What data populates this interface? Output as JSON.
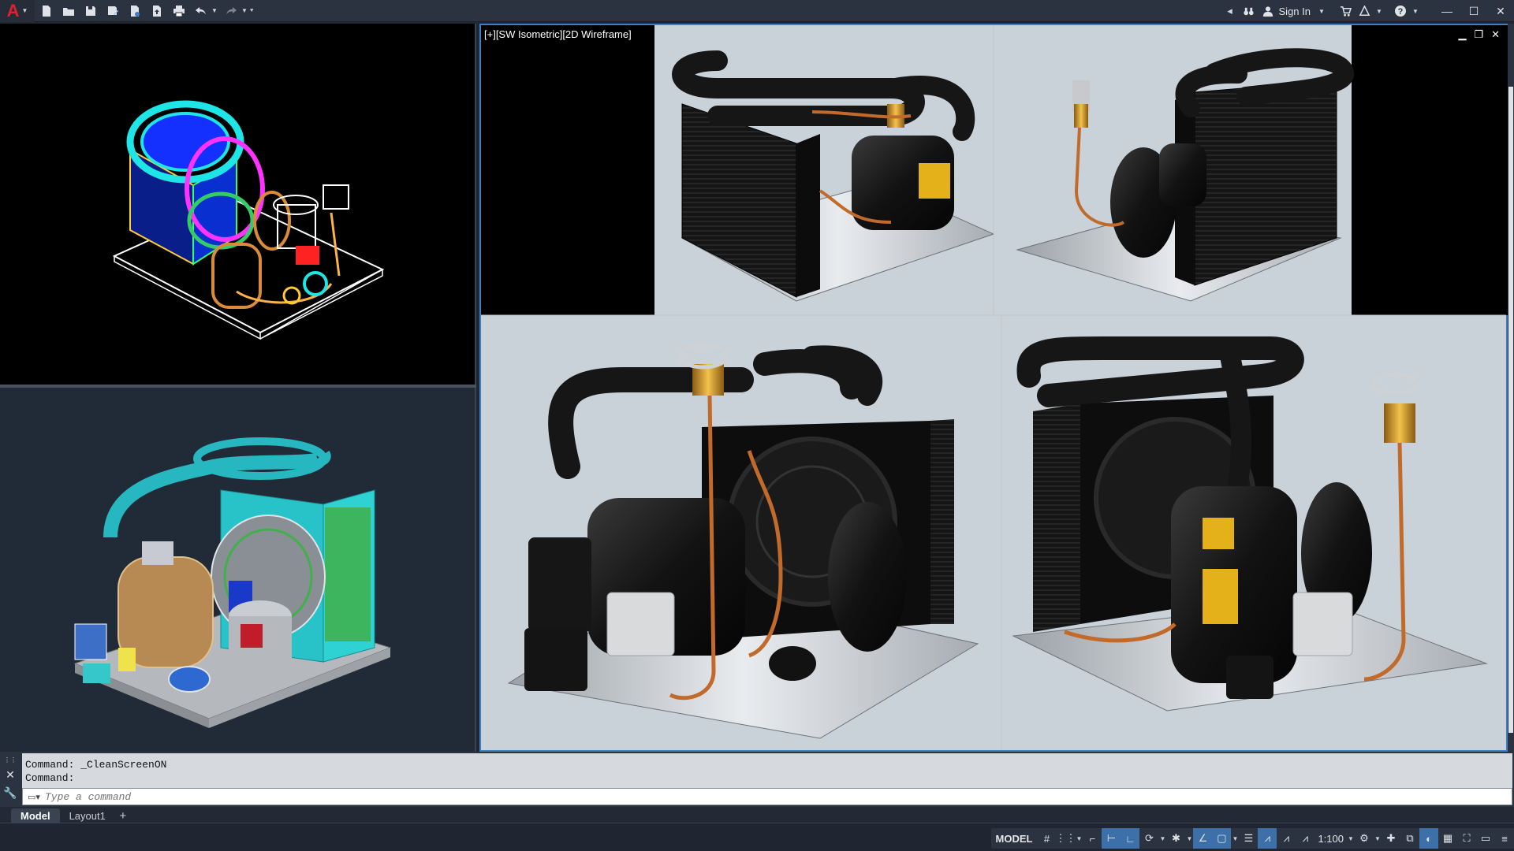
{
  "titlebar": {
    "signin_label": "Sign In"
  },
  "viewport": {
    "main_label": "[+][SW Isometric][2D Wireframe]"
  },
  "command": {
    "history": [
      "Command: _CleanScreenON",
      "Command:"
    ],
    "placeholder": "Type a command"
  },
  "tabs": {
    "model": "Model",
    "layout1": "Layout1",
    "add": "+"
  },
  "status": {
    "model_label": "MODEL",
    "scale": "1:100"
  },
  "colors": {
    "accent": "#3e7fc4",
    "brand_red": "#e2202f",
    "viewport_bg": "#c9d1d9"
  }
}
